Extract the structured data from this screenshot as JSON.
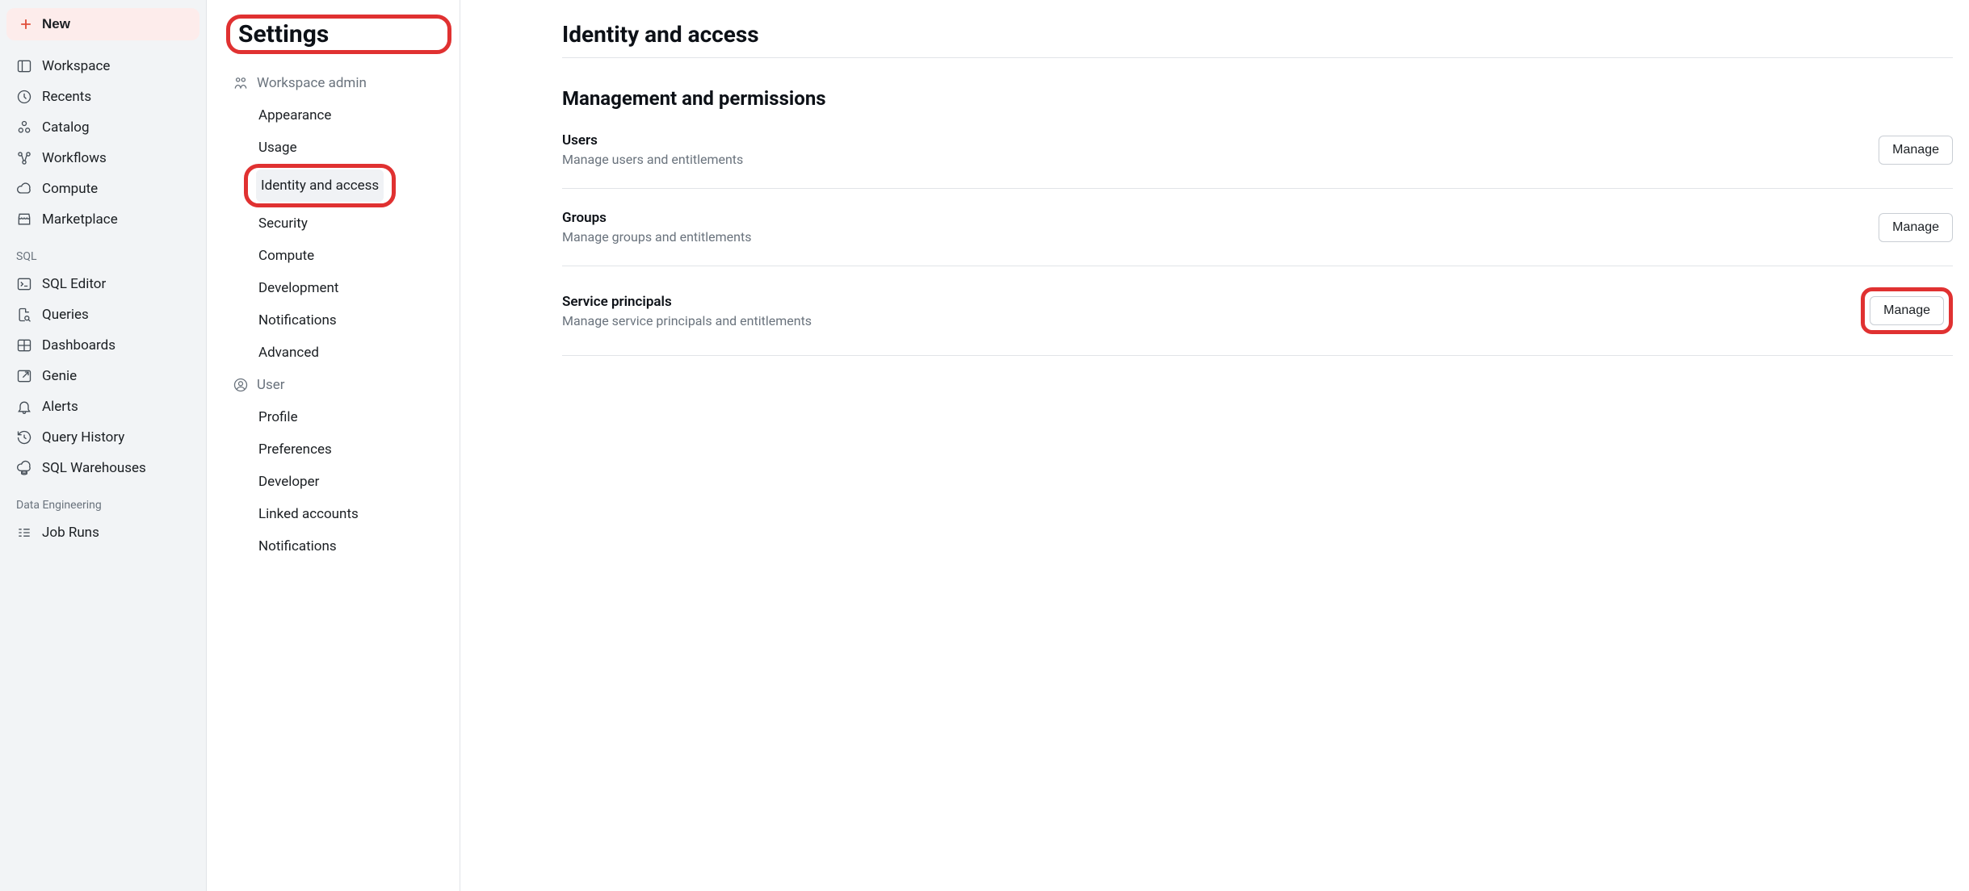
{
  "nav": {
    "newLabel": "New",
    "primary": [
      {
        "id": "workspace",
        "label": "Workspace"
      },
      {
        "id": "recents",
        "label": "Recents"
      },
      {
        "id": "catalog",
        "label": "Catalog"
      },
      {
        "id": "workflows",
        "label": "Workflows"
      },
      {
        "id": "compute",
        "label": "Compute"
      },
      {
        "id": "marketplace",
        "label": "Marketplace"
      }
    ],
    "sections": [
      {
        "label": "SQL",
        "items": [
          {
            "id": "sql-editor",
            "label": "SQL Editor"
          },
          {
            "id": "queries",
            "label": "Queries"
          },
          {
            "id": "dashboards",
            "label": "Dashboards"
          },
          {
            "id": "genie",
            "label": "Genie"
          },
          {
            "id": "alerts",
            "label": "Alerts"
          },
          {
            "id": "query-history",
            "label": "Query History"
          },
          {
            "id": "sql-warehouses",
            "label": "SQL Warehouses"
          }
        ]
      },
      {
        "label": "Data Engineering",
        "items": [
          {
            "id": "job-runs",
            "label": "Job Runs"
          }
        ]
      }
    ]
  },
  "settings": {
    "title": "Settings",
    "groups": [
      {
        "id": "workspace-admin",
        "label": "Workspace admin",
        "items": [
          {
            "id": "appearance",
            "label": "Appearance"
          },
          {
            "id": "usage",
            "label": "Usage"
          },
          {
            "id": "identity-access",
            "label": "Identity and access",
            "active": true
          },
          {
            "id": "security",
            "label": "Security"
          },
          {
            "id": "compute-settings",
            "label": "Compute"
          },
          {
            "id": "development",
            "label": "Development"
          },
          {
            "id": "notifications-ws",
            "label": "Notifications"
          },
          {
            "id": "advanced",
            "label": "Advanced"
          }
        ]
      },
      {
        "id": "user",
        "label": "User",
        "items": [
          {
            "id": "profile",
            "label": "Profile"
          },
          {
            "id": "preferences",
            "label": "Preferences"
          },
          {
            "id": "developer",
            "label": "Developer"
          },
          {
            "id": "linked-accounts",
            "label": "Linked accounts"
          },
          {
            "id": "notifications-user",
            "label": "Notifications"
          }
        ]
      }
    ]
  },
  "content": {
    "pageTitle": "Identity and access",
    "section": "Management and permissions",
    "rows": [
      {
        "id": "users",
        "title": "Users",
        "desc": "Manage users and entitlements",
        "btn": "Manage",
        "highlight": false
      },
      {
        "id": "groups",
        "title": "Groups",
        "desc": "Manage groups and entitlements",
        "btn": "Manage",
        "highlight": false
      },
      {
        "id": "sp",
        "title": "Service principals",
        "desc": "Manage service principals and entitlements",
        "btn": "Manage",
        "highlight": true
      }
    ]
  }
}
